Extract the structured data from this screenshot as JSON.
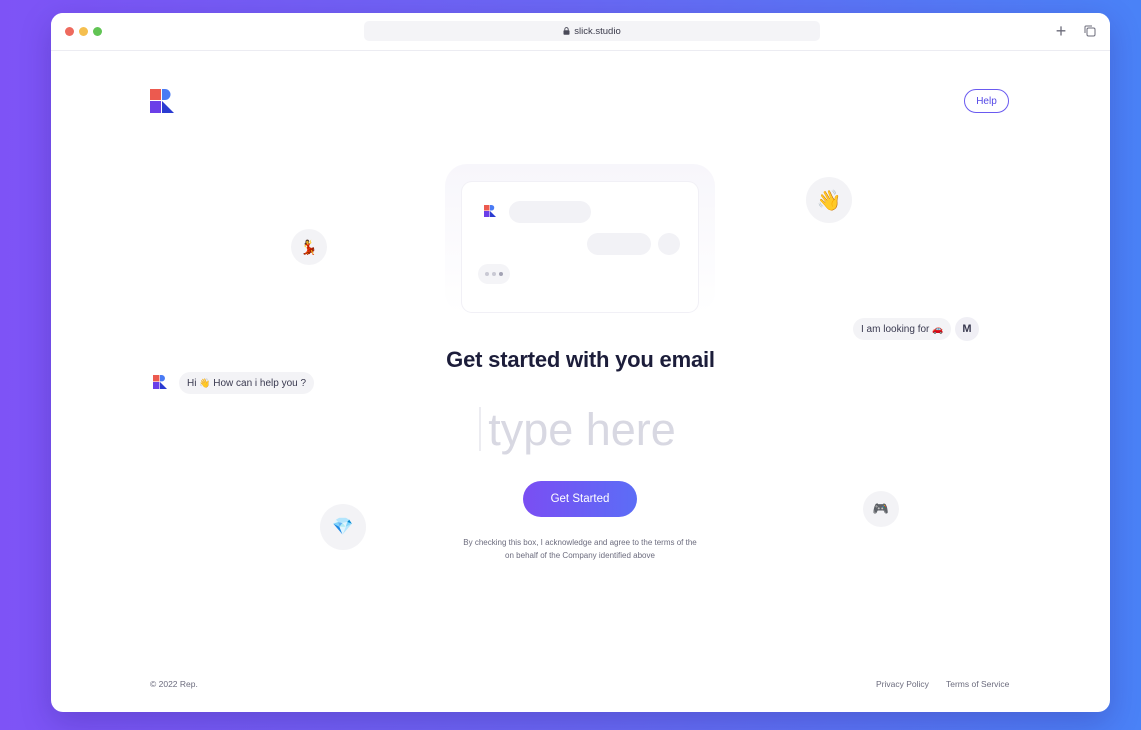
{
  "browser": {
    "url": "slick.studio"
  },
  "header": {
    "help_label": "Help"
  },
  "chat": {
    "greeting_prefix": "Hi",
    "greeting_wave": "👋",
    "greeting_suffix": "How can i help you ?",
    "looking_for": "I am looking for",
    "looking_for_emoji": "🚗",
    "user_initial": "M"
  },
  "floating_emojis": {
    "wave": "👋",
    "dancer": "💃",
    "gem": "💎",
    "gamepad": "🎮"
  },
  "main": {
    "title": "Get started with you email",
    "email_placeholder": "type here",
    "cta_label": "Get Started",
    "terms_line1": "By checking this box, I acknowledge and agree to the terms of the",
    "terms_line2": "on behalf of the Company identified above"
  },
  "footer": {
    "copyright": "© 2022 Rep.",
    "privacy": "Privacy Policy",
    "terms": "Terms of Service"
  },
  "colors": {
    "background_start": "#7e53f6",
    "background_end": "#4a82f7",
    "accent": "#5c6df6",
    "logo_red": "#ec5a4f",
    "logo_blue": "#4a7bf4",
    "logo_purple": "#6b3fe8"
  }
}
